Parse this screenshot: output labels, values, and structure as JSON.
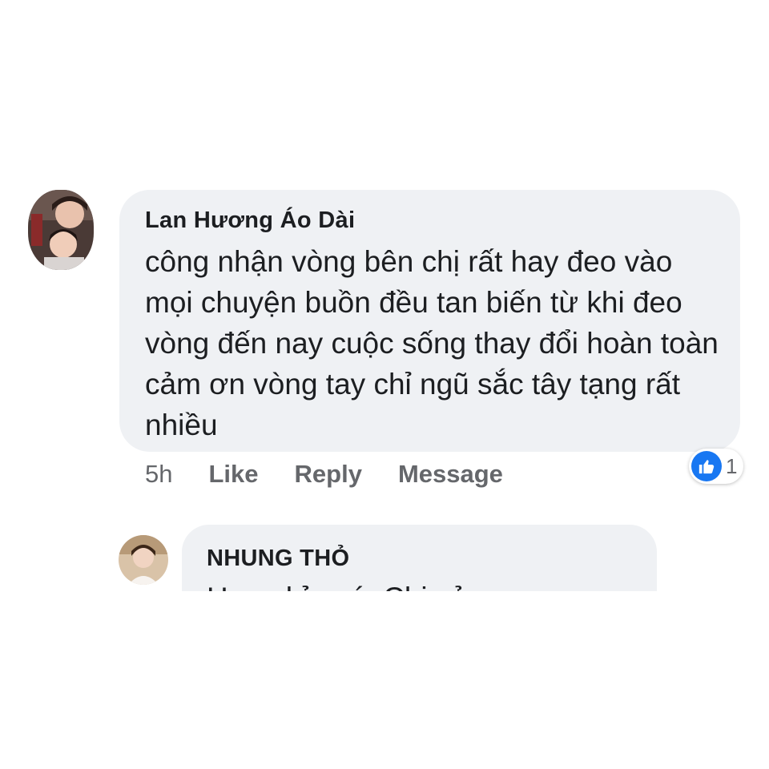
{
  "comments": [
    {
      "author": "Lan Hương Áo Dài",
      "text": "công nhận vòng bên chị rất hay đeo vào mọi chuyện buồn đều tan biến từ khi đeo vòng đến nay cuộc sống thay đổi hoàn toàn cảm ơn vòng tay chỉ ngũ sắc tây tạng rất nhiều",
      "time": "5h",
      "actions": [
        "Like",
        "Reply",
        "Message"
      ],
      "reaction_icon": "like-thumbs-up-icon",
      "reaction_count": "1"
    },
    {
      "author": "NHUNG THỎ",
      "text": "Hoan hỉ quá. Chị cảm ơn em"
    }
  ],
  "colors": {
    "bubble": "#eff1f4",
    "text": "#1c1e21",
    "meta": "#65676b",
    "like_blue": "#1877f2"
  }
}
